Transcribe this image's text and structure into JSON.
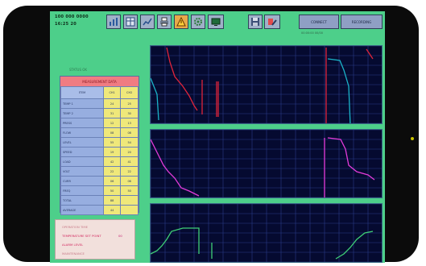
{
  "clock": {
    "date": "100 000 0000",
    "time": "16:25 20"
  },
  "toolbar": {
    "buttons": [
      {
        "name": "chart-view-button",
        "icon": "chart-icon"
      },
      {
        "name": "table-view-button",
        "icon": "table-icon"
      },
      {
        "name": "trend-view-button",
        "icon": "trend-icon"
      },
      {
        "name": "print-button",
        "icon": "printer-icon"
      },
      {
        "name": "alarm-button",
        "icon": "warning-icon"
      },
      {
        "name": "settings-button",
        "icon": "gear-icon"
      },
      {
        "name": "screen-button",
        "icon": "monitor-icon"
      },
      {
        "name": "save-button",
        "icon": "disk-icon"
      },
      {
        "name": "tools-button",
        "icon": "wrench-icon"
      }
    ],
    "mode_a_label": "CONNECT",
    "mode_b_label": "RECORDING",
    "status_text": "00:00:00     00/00"
  },
  "side_caption": "STATUS  OK",
  "data_panel": {
    "title": "MEASUREMENT DATA",
    "column_headers": [
      "ITEM",
      "CH1",
      "CH2"
    ],
    "rows": [
      [
        "TEMP 1",
        "24",
        "25"
      ],
      [
        "TEMP 2",
        "31",
        "30"
      ],
      [
        "PRESS",
        "12",
        "13"
      ],
      [
        "FLOW",
        "08",
        "08"
      ],
      [
        "LEVEL",
        "55",
        "54"
      ],
      [
        "SPEED",
        "19",
        "20"
      ],
      [
        "LOAD",
        "42",
        "41"
      ],
      [
        "VOLT",
        "22",
        "22"
      ],
      [
        "CURR",
        "06",
        "06"
      ],
      [
        "FREQ",
        "50",
        "50"
      ],
      [
        "TOTAL",
        "88",
        ""
      ],
      [
        "AVERAGE",
        "44",
        ""
      ]
    ]
  },
  "info_box": {
    "lines": [
      {
        "label": "OPERATION TIME",
        "value": "",
        "color": "#c87a88"
      },
      {
        "label": "TEMPERATURE SET POINT",
        "value": "00",
        "color": "#d2285f"
      },
      {
        "label": "ALARM LEVEL",
        "value": "",
        "color": "#d2285f"
      },
      {
        "label": "MAINTENANCE",
        "value": "",
        "color": "#c87a88"
      }
    ]
  },
  "colors": {
    "graph_bg": "#050a30",
    "grid": "#2a3b88",
    "trace_red": "#e0243a",
    "trace_cyan": "#1ab3c8",
    "trace_magenta": "#e43bd9",
    "trace_green": "#3fcf76"
  }
}
